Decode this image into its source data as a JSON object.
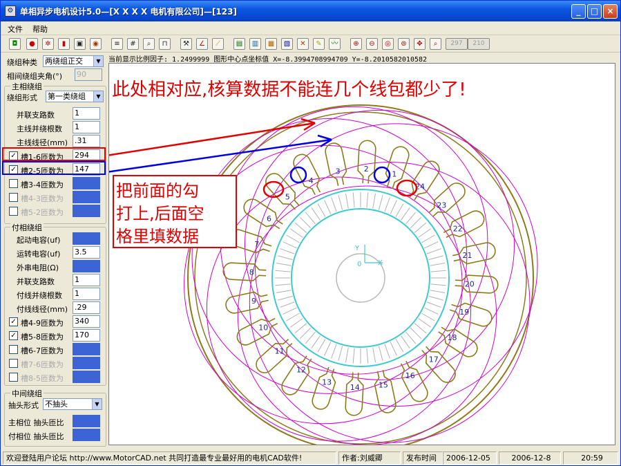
{
  "window": {
    "title": "单相异步电机设计5.0—[X X X X 电机有限公司]—[123]"
  },
  "menu": [
    "文件",
    "帮助"
  ],
  "toolbar": {
    "field1": "297",
    "field2": "210"
  },
  "winding": {
    "type_label": "绕组种类",
    "type_value": "两绕组正交",
    "angle_label": "相间绕组夹角(°)",
    "angle_value": "90"
  },
  "main": {
    "group_title": "主相绕组",
    "form_label": "绕组形式",
    "form_value": "第一类绕组",
    "fields": [
      {
        "label": "并联支路数",
        "value": "1"
      },
      {
        "label": "主线并绕根数",
        "value": "1"
      },
      {
        "label": "主线线径(mm)",
        "value": ".31"
      }
    ],
    "turns": [
      {
        "label": "槽1-6匝数为",
        "value": "294",
        "checked": true
      },
      {
        "label": "槽2-5匝数为",
        "value": "147",
        "checked": true
      },
      {
        "label": "槽3-4匝数为",
        "value": "",
        "checked": false
      },
      {
        "label": "槽4-3匝数为",
        "value": "",
        "checked": false
      },
      {
        "label": "槽5-2匝数为",
        "value": "",
        "checked": false
      }
    ]
  },
  "aux": {
    "group_title": "付相绕组",
    "fields": [
      {
        "label": "起动电容(uf)",
        "value": ""
      },
      {
        "label": "运转电容(uf)",
        "value": "3.5"
      },
      {
        "label": "外串电阻(Ω)",
        "value": ""
      },
      {
        "label": "并联支路数",
        "value": "1"
      },
      {
        "label": "付线并绕根数",
        "value": "1"
      },
      {
        "label": "付线线径(mm)",
        "value": ".29"
      }
    ],
    "turns": [
      {
        "label": "槽4-9匝数为",
        "value": "340",
        "checked": true
      },
      {
        "label": "槽5-8匝数为",
        "value": "170",
        "checked": true
      },
      {
        "label": "槽6-7匝数为",
        "value": "",
        "checked": false
      },
      {
        "label": "槽7-6匝数为",
        "value": "",
        "checked": false
      },
      {
        "label": "槽8-5匝数为",
        "value": "",
        "checked": false
      }
    ]
  },
  "middle": {
    "group_title": "中间绕组",
    "tap_label": "抽头形式",
    "tap_value": "不抽头",
    "main_ratio_label": "主相位 抽头匝比",
    "aux_ratio_label": "付相位 抽头匝比"
  },
  "scale_info": "当前显示比例因子: 1.2499999  图形中心点坐标值 X=-8.3994708994709 Y=-8.2010582010582",
  "annotation": {
    "headline": "此处相对应,核算数据不能连几个线包都少了!",
    "note_lines": [
      "把前面的勾",
      "打上,后面空",
      "格里填数据"
    ]
  },
  "drawing": {
    "slots": [
      "1",
      "2",
      "3",
      "4",
      "5",
      "6",
      "7",
      "8",
      "9",
      "10",
      "11",
      "12",
      "13",
      "14",
      "15",
      "16",
      "17",
      "18",
      "19",
      "20",
      "21",
      "22",
      "23",
      "24"
    ],
    "axis_x": "X",
    "axis_y": "Y",
    "origin": "0"
  },
  "status": {
    "welcome": "欢迎登陆用户论坛 http://www.MotorCAD.net 共同打造最专业最好用的电机CAD软件!",
    "author": "作者:刘威卿",
    "release_label": "发布时间",
    "release_date": "2006-12-05",
    "date": "2006-12-8",
    "time": "20:59"
  },
  "colors": {
    "stator": "#8b7a17",
    "coil": "#cc00cc",
    "rotor": "#40c8d0",
    "highlight_red": "#e00000",
    "highlight_blue": "#0000e0"
  }
}
